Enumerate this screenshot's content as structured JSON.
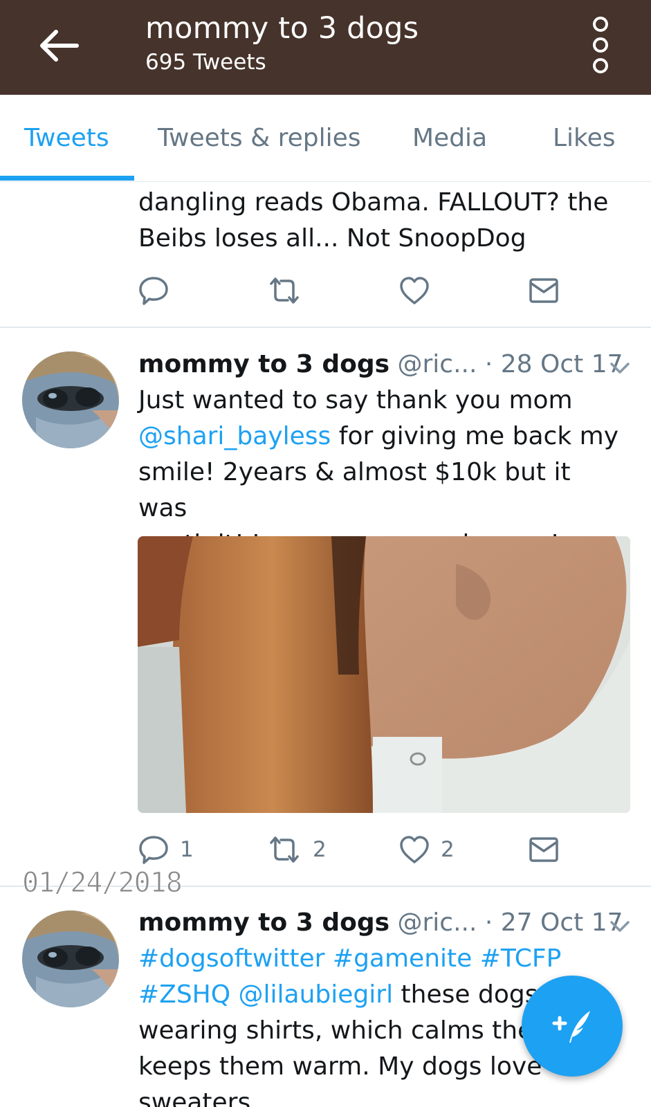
{
  "header": {
    "title": "mommy to 3 dogs",
    "subtitle": "695 Tweets",
    "back_icon": "arrow-left-icon",
    "overflow_icon": "overflow-menu-icon"
  },
  "tabs": [
    {
      "label": "Tweets",
      "active": true
    },
    {
      "label": "Tweets & replies",
      "active": false
    },
    {
      "label": "Media",
      "active": false
    },
    {
      "label": "Likes",
      "active": false
    }
  ],
  "colors": {
    "header_bg": "#46332b",
    "accent": "#1da1f2",
    "muted": "#657786"
  },
  "tweets": [
    {
      "text_lines": [
        "dangling reads Obama. FALLOUT? the",
        "Beibs loses all... Not SnoopDog"
      ],
      "reply_count": "",
      "retweet_count": "",
      "like_count": ""
    },
    {
      "name": "mommy to 3 dogs",
      "handle": "@ric...",
      "date": "· 28 Oct 17",
      "line1": "Just wanted to say thank you mom",
      "mention": "@shari_bayless",
      "line2_rest": " for giving me back my",
      "line3": "smile! 2years & almost $10k but it was",
      "line4": "worth it! Love you so much mom!",
      "reply_count": "1",
      "retweet_count": "2",
      "like_count": "2"
    },
    {
      "name": "mommy to 3 dogs",
      "handle": "@ric...",
      "date": "· 27 Oct 17",
      "hashtags_line1": "#dogsoftwitter #gamenite #TCFP",
      "hashtag_zshq": "#ZSHQ",
      "mention": "@lilaubiegirl",
      "line2_rest": " these dogs",
      "line3": "wearing shirts, which calms the",
      "line4": "keeps them warm. My dogs love",
      "line5": "sweaters"
    }
  ],
  "overlay_date_stamp": "01/24/2018",
  "fab": {
    "icon": "compose-tweet-icon"
  }
}
